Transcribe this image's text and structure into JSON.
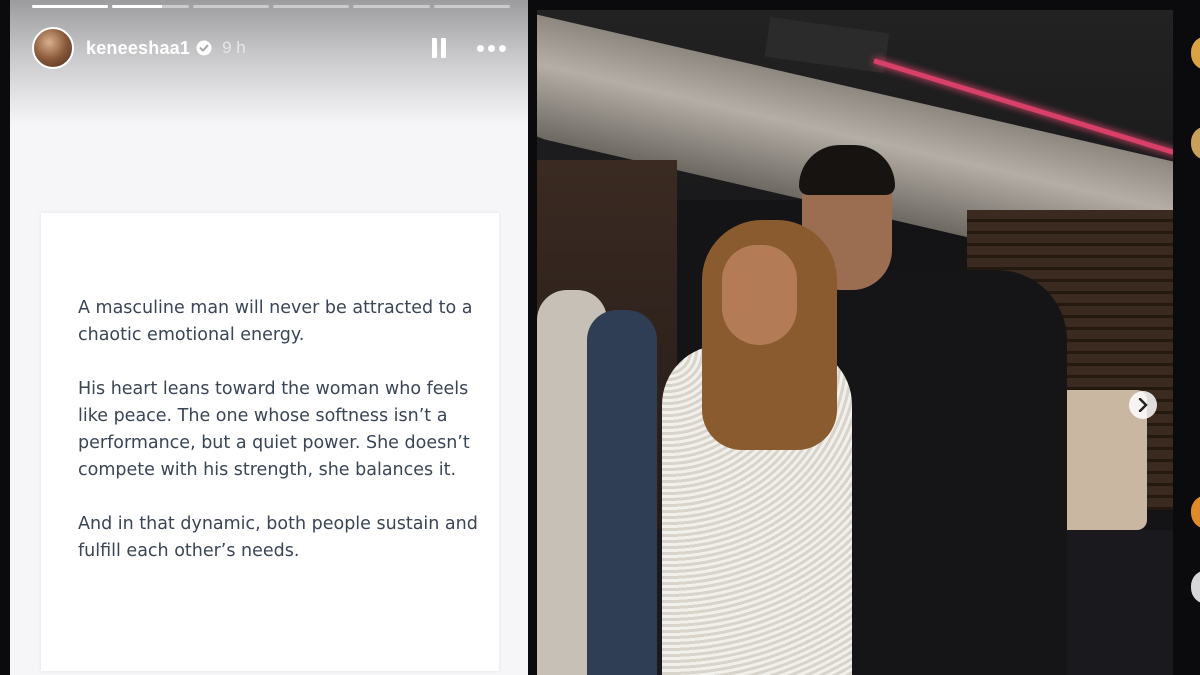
{
  "story": {
    "progress_segments": [
      1.0,
      0.65,
      0,
      0,
      0,
      0
    ],
    "username": "keneeshaa1",
    "verified": true,
    "time_ago": "9 h",
    "pause_icon": "pause-icon",
    "more_icon": "more-horizontal-icon"
  },
  "quote": {
    "paragraphs": [
      "A masculine man will never be attracted to a chaotic emotional energy.",
      "His heart leans toward the woman who feels like peace. The one whose softness isn’t a performance, but a quiet power. She doesn’t compete with his strength, she balances it.",
      "And in that dynamic, both people sustain and fulfill each other’s needs."
    ]
  },
  "photo": {
    "next_icon": "chevron-right-icon"
  },
  "colors": {
    "story_bg": "#f6f6f8",
    "quote_text": "#3a4556",
    "photo_bg": "#141416"
  }
}
